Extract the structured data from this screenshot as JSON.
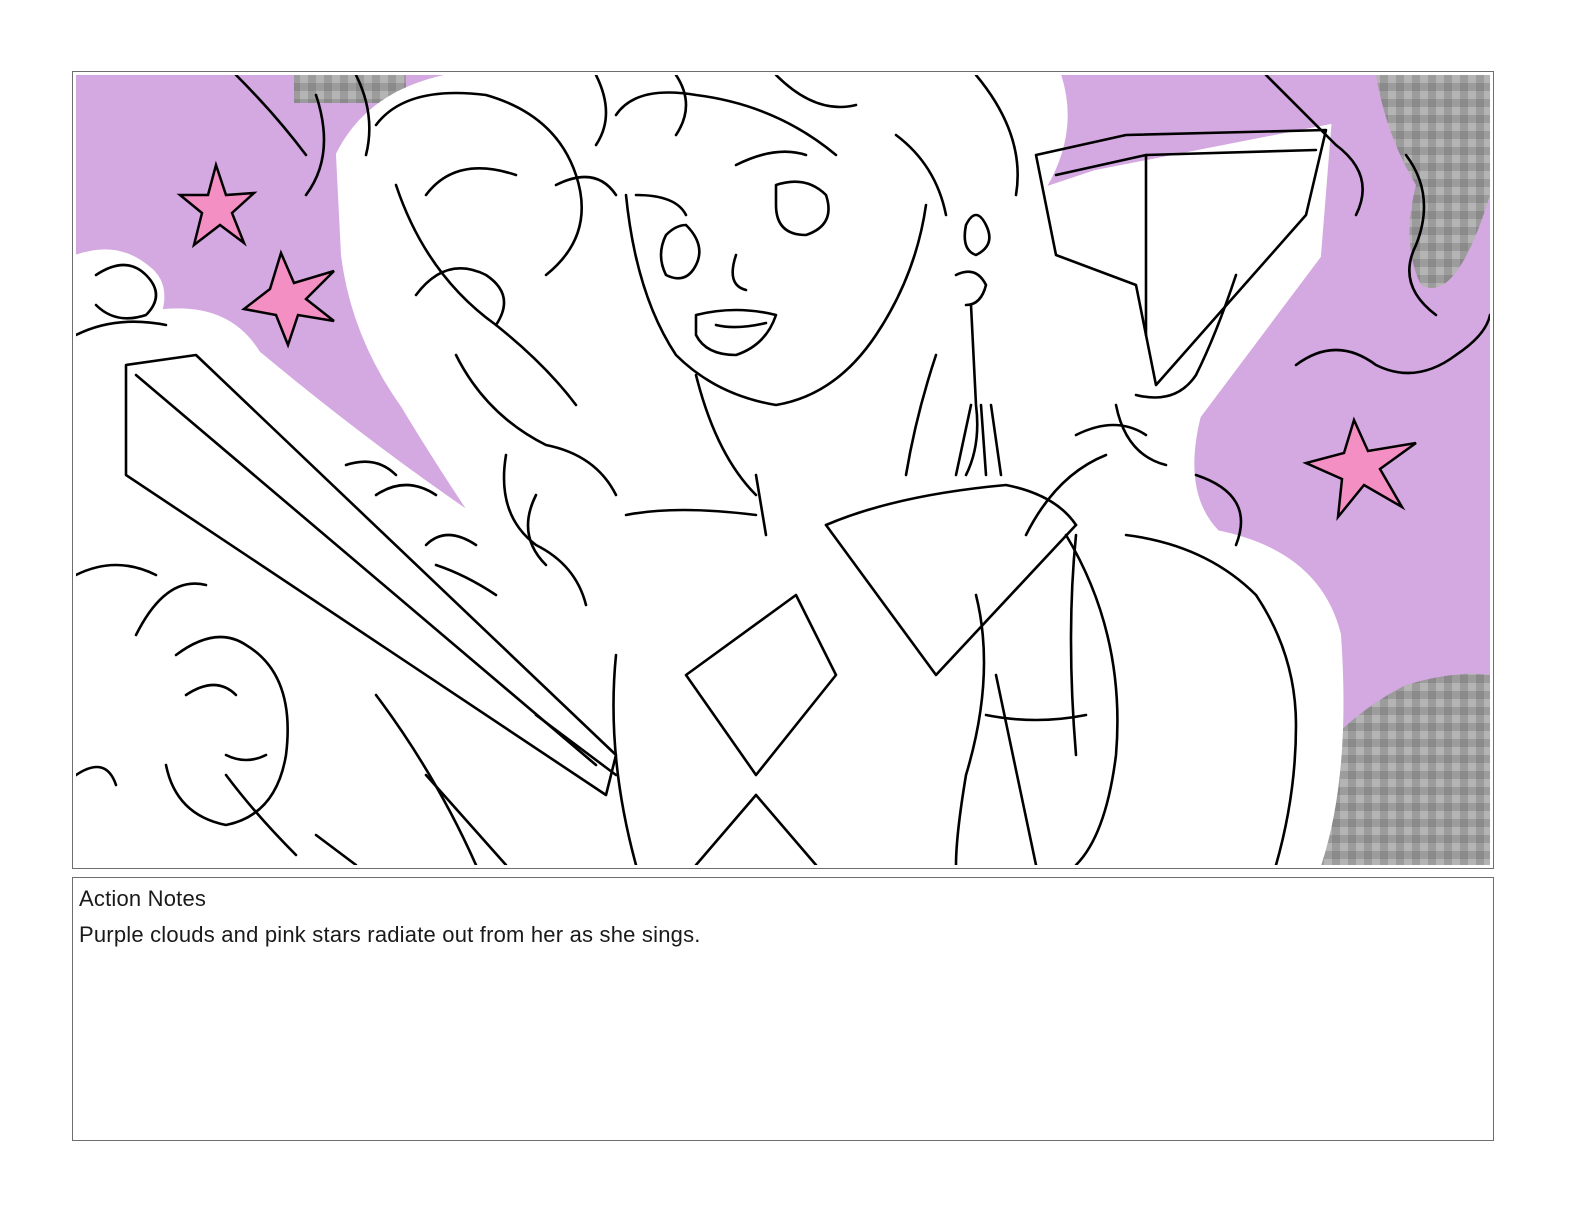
{
  "panel": {
    "background_color": "#d4a8e0",
    "star_color": "#f48fc4",
    "cloud_color": "#9a9a9a",
    "line_color": "#000000"
  },
  "notes": {
    "title": "Action Notes",
    "body": "Purple clouds and pink stars radiate out from her as she sings."
  }
}
